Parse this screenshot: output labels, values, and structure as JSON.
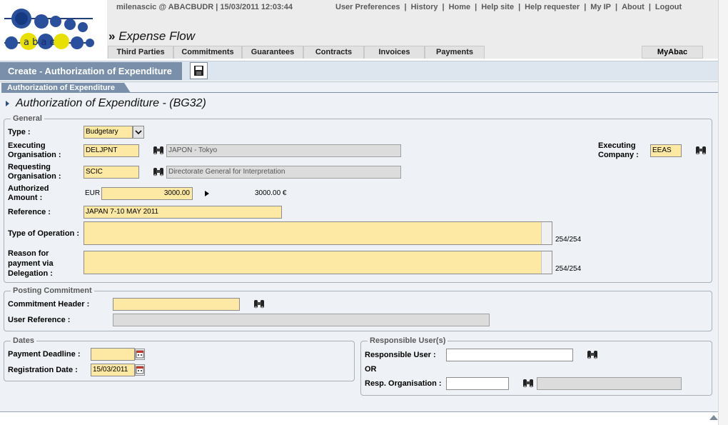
{
  "header": {
    "user_info": "milenascic @ ABACBUDR  |  15/03/2011 12:03:44",
    "nav": [
      "User Preferences",
      "History",
      "Home",
      "Help site",
      "Help requester",
      "My IP",
      "About",
      "Logout"
    ],
    "app_prefix": "»",
    "app_title": "Expense Flow",
    "tabs": [
      "Third Parties",
      "Commitments",
      "Guarantees",
      "Contracts",
      "Invoices",
      "Payments"
    ],
    "my_abac": "MyAbac",
    "logo_text": "abac"
  },
  "action_bar": {
    "title": "Create - Authorization of Expenditure",
    "save_icon": "floppy-disk-icon"
  },
  "breadcrumb": "Authorization of Expenditure",
  "page_title": "Authorization of Expenditure - (BG32)",
  "general": {
    "legend": "General",
    "type_label": "Type :",
    "type_value": "Budgetary",
    "exec_org_label": "Executing Organisation :",
    "exec_org_code": "DELJPNT",
    "exec_org_name": "JAPON - Tokyo",
    "exec_company_label": "Executing Company :",
    "exec_company_code": "EEAS",
    "req_org_label": "Requesting Organisation :",
    "req_org_code": "SCIC",
    "req_org_name": "Directorate General for Interpretation",
    "amount_label": "Authorized Amount :",
    "currency": "EUR",
    "amount": "3000.00",
    "amount_converted": "3000.00 €",
    "reference_label": "Reference :",
    "reference": "JAPAN 7-10 MAY 2011",
    "type_op_label": "Type of Operation :",
    "type_op_value": "",
    "type_op_counter": "254/254",
    "reason_label": "Reason for payment via Delegation :",
    "reason_value": "",
    "reason_counter": "254/254"
  },
  "posting": {
    "legend": "Posting Commitment",
    "header_label": "Commitment Header :",
    "header_value": "",
    "user_ref_label": "User Reference :",
    "user_ref_value": ""
  },
  "dates": {
    "legend": "Dates",
    "deadline_label": "Payment Deadline :",
    "deadline_value": "",
    "registration_label": "Registration Date :",
    "registration_value": "15/03/2011"
  },
  "responsible": {
    "legend": "Responsible User(s)",
    "user_label": "Responsible User :",
    "user_value": "",
    "or_text": "OR",
    "org_label": "Resp. Organisation :",
    "org_value": "",
    "org_name": ""
  }
}
